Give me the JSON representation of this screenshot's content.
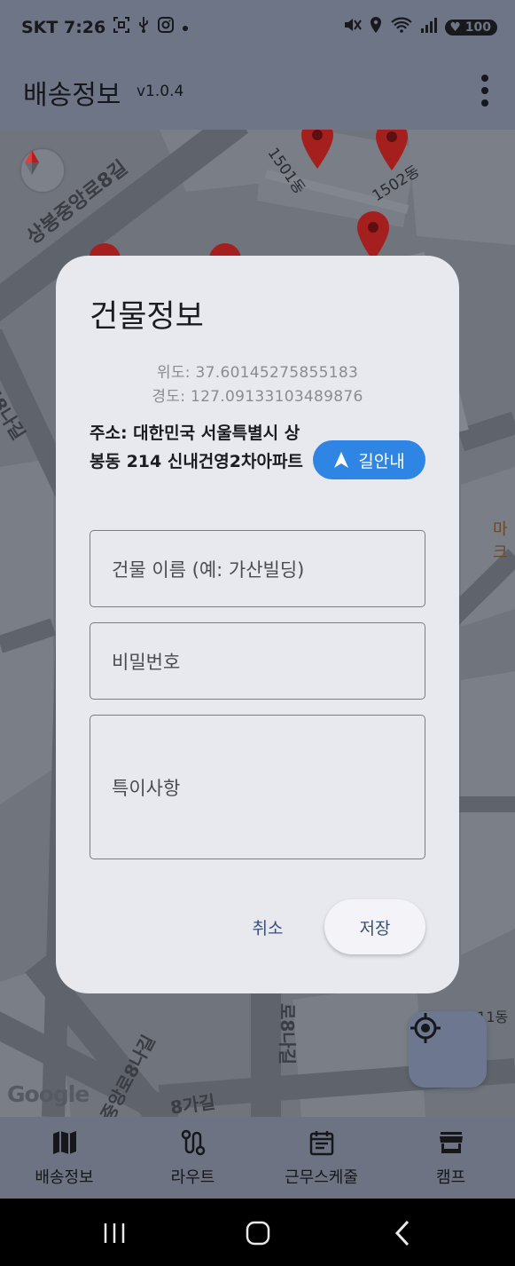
{
  "status_bar": {
    "carrier_time": "SKT 7:26",
    "battery": "100",
    "icons": [
      "screenshot-icon",
      "usb-icon",
      "instagram-icon",
      "dot-icon",
      "mute-icon",
      "location-icon",
      "wifi-icon",
      "signal-icon",
      "battery-icon"
    ]
  },
  "app_bar": {
    "title": "배송정보",
    "version": "v1.0.4",
    "menu_icon": "more-vert-icon"
  },
  "map": {
    "labels": {
      "road1": "상봉중앙로8길",
      "road2": "로8나길",
      "road3": "상봉중앙로8나길",
      "road4": "로8나길",
      "road5": "8가길",
      "bldg1": "1501동",
      "bldg2": "1502동",
      "bldg3": "211동",
      "mart": "마크"
    },
    "logo": "Google",
    "pins": 6,
    "pin_color": "#d92b2b"
  },
  "dialog": {
    "title": "건물정보",
    "latitude": "위도: 37.60145275855183",
    "longitude": "경도: 127.09133103489876",
    "address": "주소: 대한민국 서울특별시 상봉동 214 신내건영2차아파트",
    "navigate_label": "길안내",
    "building_name_placeholder": "건물 이름 (예: 가산빌딩)",
    "password_placeholder": "비밀번호",
    "notes_placeholder": "특이사항",
    "cancel_label": "취소",
    "save_label": "저장",
    "accent_color": "#2f85e4"
  },
  "bottom_nav": {
    "items": [
      {
        "label": "배송정보",
        "icon": "map-icon"
      },
      {
        "label": "라우트",
        "icon": "route-icon"
      },
      {
        "label": "근무스케줄",
        "icon": "calendar-icon"
      },
      {
        "label": "캠프",
        "icon": "store-icon"
      }
    ]
  },
  "system_nav": {
    "icons": [
      "recents-icon",
      "home-icon",
      "back-icon"
    ]
  }
}
